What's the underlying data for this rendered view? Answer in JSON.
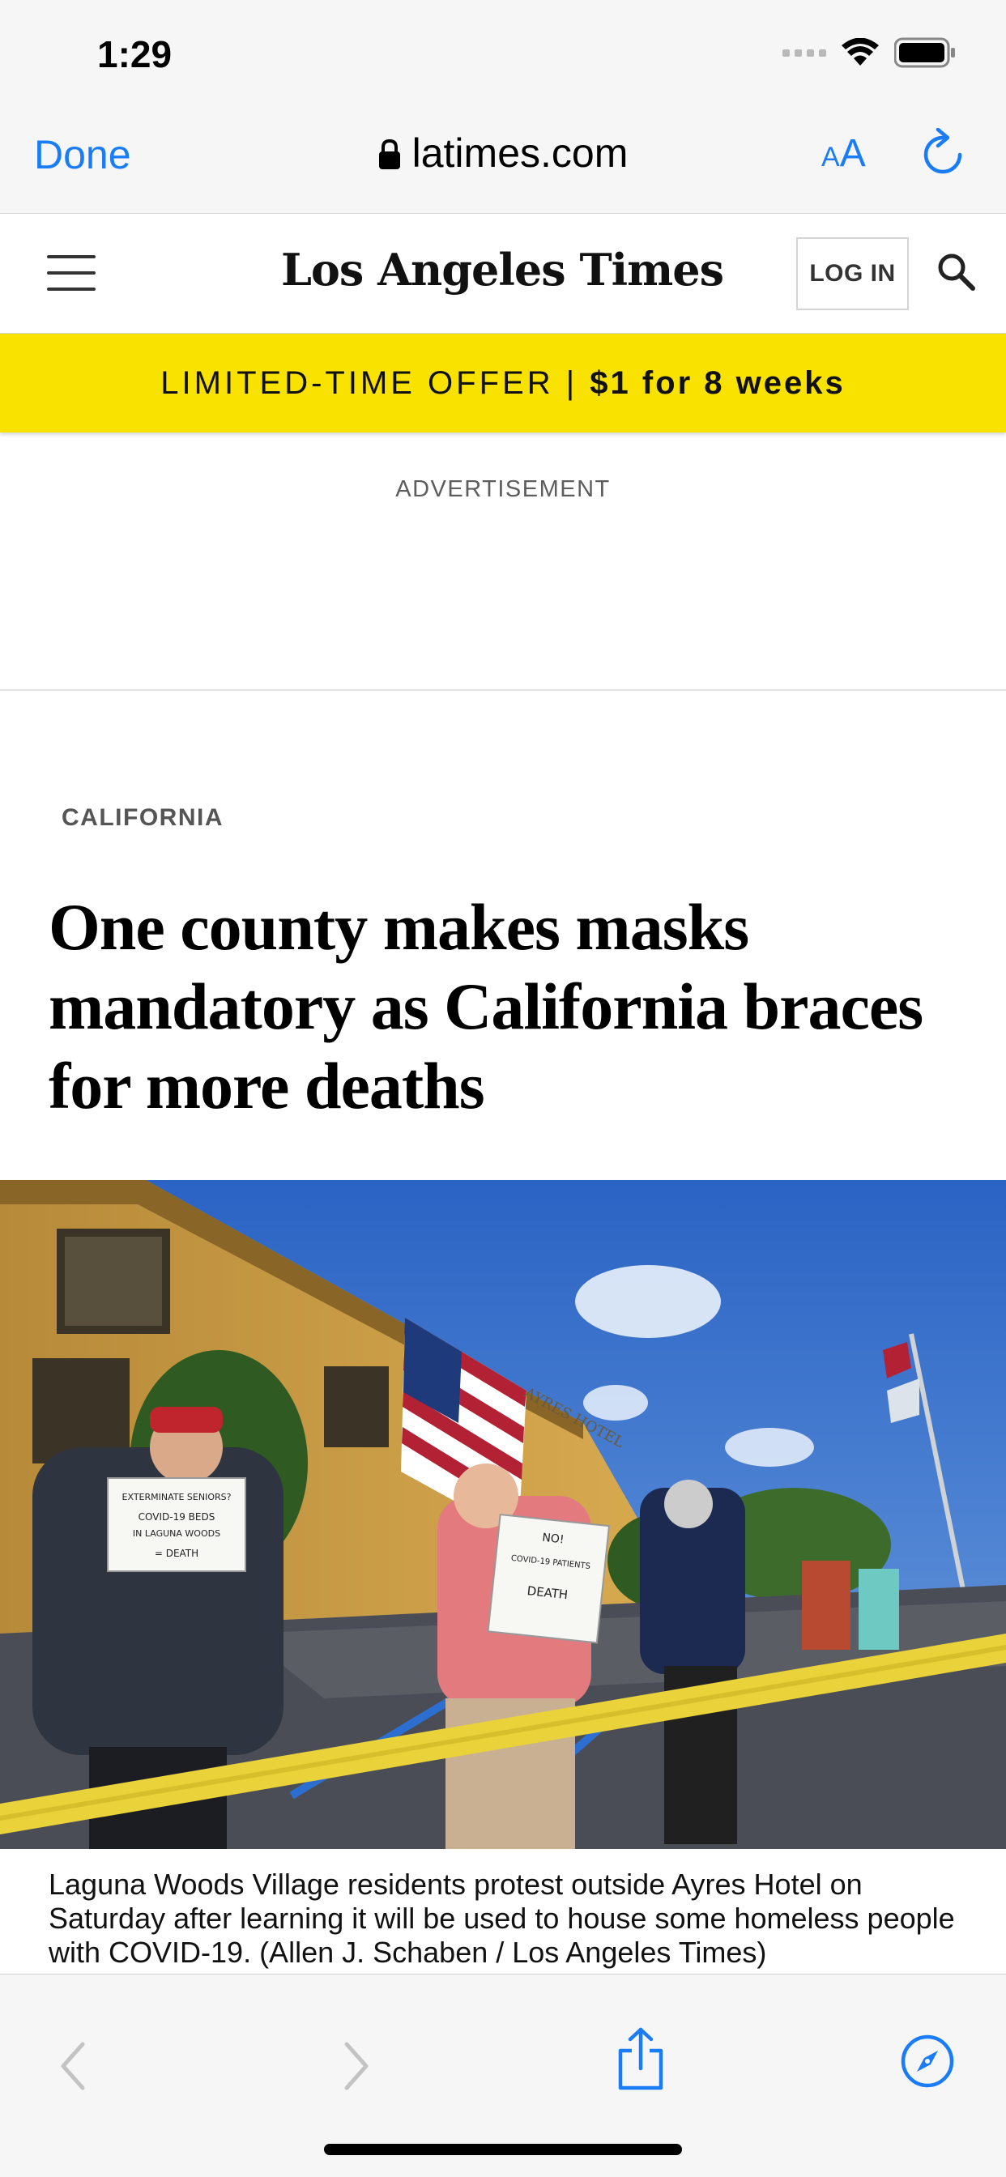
{
  "status_bar": {
    "time": "1:29"
  },
  "browser": {
    "done_label": "Done",
    "domain": "latimes.com",
    "text_size_label_small": "A",
    "text_size_label_large": "A"
  },
  "site_header": {
    "masthead": "Los Angeles Times",
    "login_label": "LOG IN"
  },
  "promo": {
    "prefix": "LIMITED-TIME OFFER | ",
    "offer": "$1 for 8 weeks"
  },
  "advertisement_label": "ADVERTISEMENT",
  "article": {
    "section": "CALIFORNIA",
    "headline": "One county makes masks mandatory as California braces for more deaths",
    "caption": "Laguna Woods Village residents protest outside Ayres Hotel on Saturday after learning it will be used to house some homeless people with COVID-19. (Allen J. Schaben / Los Angeles Times)",
    "photo_signs": {
      "sign_left_line1": "EXTERMINATE SENIORS?",
      "sign_left_line2": "COVID-19 BEDS",
      "sign_left_line3": "IN LAGUNA WOODS",
      "sign_left_line4": "= DEATH",
      "sign_right_line1": "NO!",
      "sign_right_line2": "COVID-19 PATIENTS",
      "sign_right_line3": "DEATH",
      "hotel_sign": "AYRES HOTEL"
    }
  },
  "colors": {
    "accent_blue": "#1a7cf6",
    "promo_yellow": "#f9e100",
    "chrome_gray": "#f6f6f6"
  },
  "icons": {
    "lock": "lock-icon",
    "reload": "reload-icon",
    "menu": "hamburger-icon",
    "search": "search-icon",
    "back": "chevron-left-icon",
    "forward": "chevron-right-icon",
    "share": "share-icon",
    "safari": "compass-icon"
  }
}
